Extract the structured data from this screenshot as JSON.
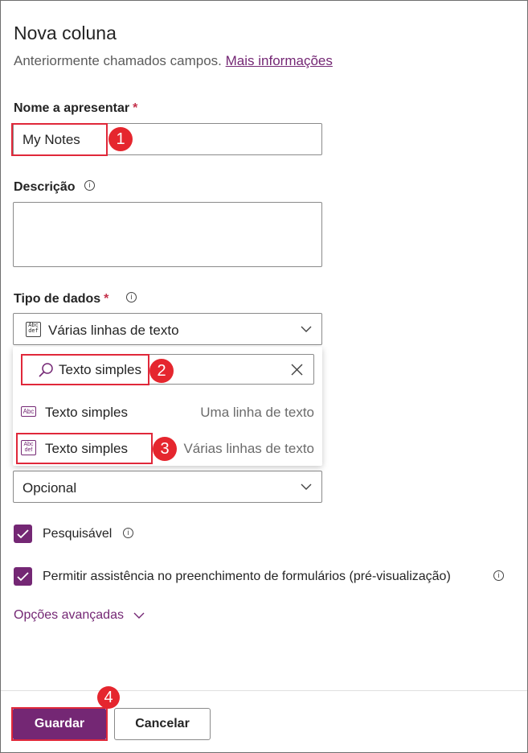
{
  "panel": {
    "title": "Nova coluna",
    "subtitle": "Anteriormente chamados campos.",
    "more_info_link": "Mais informações"
  },
  "display_name": {
    "label": "Nome a apresentar",
    "required_mark": "*",
    "value": "My Notes"
  },
  "description": {
    "label": "Descrição",
    "value": ""
  },
  "data_type": {
    "label": "Tipo de dados",
    "required_mark": "*",
    "selected": "Várias linhas de texto",
    "selected_icon": "abc-def-icon"
  },
  "type_popup": {
    "search_value": "Texto simples",
    "options": [
      {
        "name": "Texto simples",
        "description": "Uma linha de texto",
        "icon": "abc-icon"
      },
      {
        "name": "Texto simples",
        "description": "Várias linhas de texto",
        "icon": "abc-def-icon"
      }
    ]
  },
  "required_dropdown": {
    "selected": "Opcional"
  },
  "checkboxes": {
    "searchable": {
      "label": "Pesquisável",
      "checked": true
    },
    "form_assist": {
      "label": "Permitir assistência no preenchimento de formulários (pré-visualização)",
      "checked": true
    }
  },
  "advanced": {
    "label": "Opções avançadas"
  },
  "footer": {
    "save_label": "Guardar",
    "cancel_label": "Cancelar"
  },
  "callouts": {
    "step1": "1",
    "step2": "2",
    "step3": "3",
    "step4": "4"
  },
  "icon_glyphs": {
    "abc": "Abc",
    "abc_top": "Abc",
    "abc_bottom": "def",
    "info": "i"
  },
  "colors": {
    "accent": "#742774",
    "callout_red": "#e5262e",
    "required_red": "#c4314b"
  }
}
